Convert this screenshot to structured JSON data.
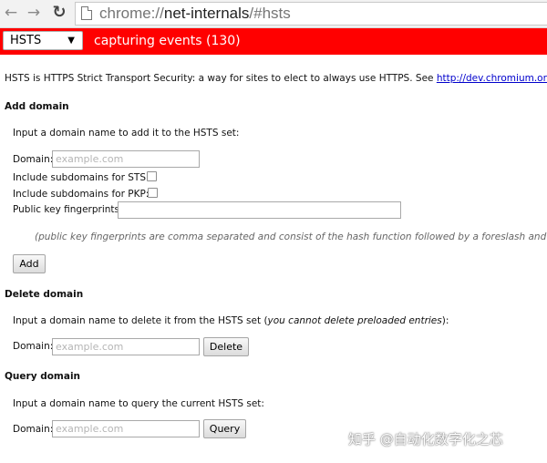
{
  "browser": {
    "url_scheme": "chrome://",
    "url_host": "net-internals",
    "url_path": "/#hsts"
  },
  "status_bar": {
    "view_selected": "HSTS",
    "capture_text": "capturing events (130)"
  },
  "intro": {
    "text": "HSTS is HTTPS Strict Transport Security: a way for sites to elect to always use HTTPS. See ",
    "link_text": "http://dev.chromium.org/sts",
    "suffix": "."
  },
  "add_domain": {
    "heading": "Add domain",
    "instruction": "Input a domain name to add it to the HSTS set:",
    "domain_label": "Domain:",
    "domain_placeholder": "example.com",
    "sts_label": "Include subdomains for STS:",
    "pkp_label": "Include subdomains for PKP:",
    "fingerprints_label": "Public key fingerprints:",
    "note": "(public key fingerprints are comma separated and consist of the hash function followed by a foreslash and th",
    "button": "Add"
  },
  "delete_domain": {
    "heading": "Delete domain",
    "instruction": "Input a domain name to delete it from the HSTS set (",
    "instruction_italic": "you cannot delete preloaded entries",
    "instruction_end": "):",
    "domain_label": "Domain:",
    "domain_placeholder": "example.com",
    "button": "Delete"
  },
  "query_domain": {
    "heading": "Query domain",
    "instruction": "Input a domain name to query the current HSTS set:",
    "domain_label": "Domain:",
    "domain_placeholder": "example.com",
    "button": "Query"
  },
  "watermark": "知乎 @自动化数字化之芯"
}
